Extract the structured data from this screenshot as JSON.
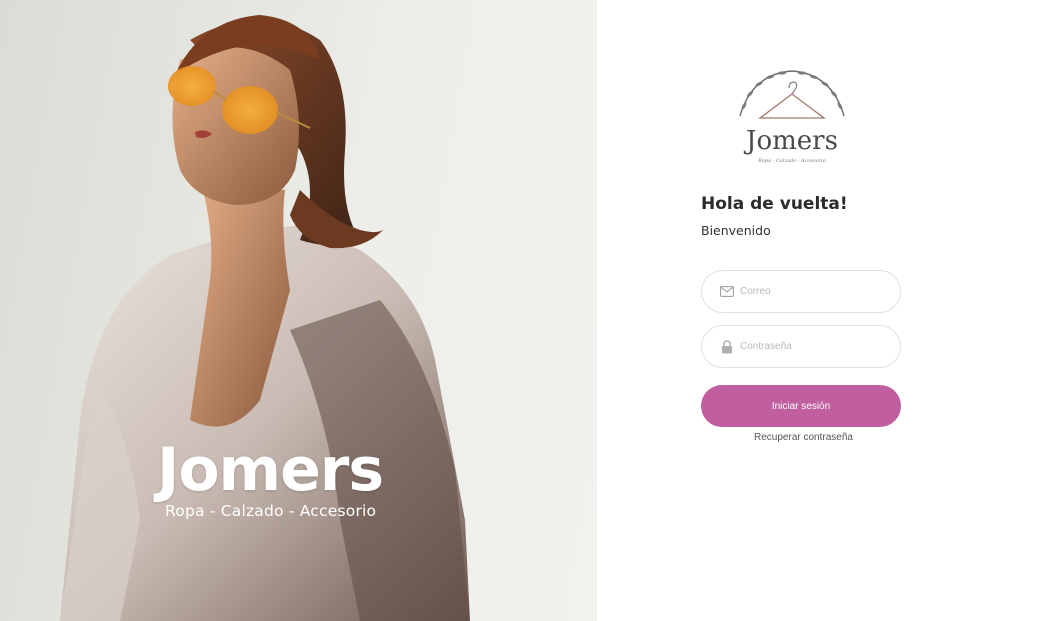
{
  "hero": {
    "brand_title": "Jomers",
    "brand_tagline": "Ropa - Calzado - Accesorio"
  },
  "logo": {
    "wordmark": "Jomers",
    "subline": "Ropa · Calzado · Accesorio"
  },
  "login": {
    "greeting": "Hola de vuelta!",
    "welcome": "Bienvenido",
    "email_placeholder": "Correo",
    "password_placeholder": "Contraseña",
    "submit_label": "Iniciar sesión",
    "recover_label": "Recuperar contraseña"
  },
  "colors": {
    "accent": "#c05e9f",
    "text_dark": "#2b2b2b",
    "field_border": "#e0e0e0"
  },
  "icons": {
    "email": "envelope-icon",
    "password": "lock-icon"
  }
}
